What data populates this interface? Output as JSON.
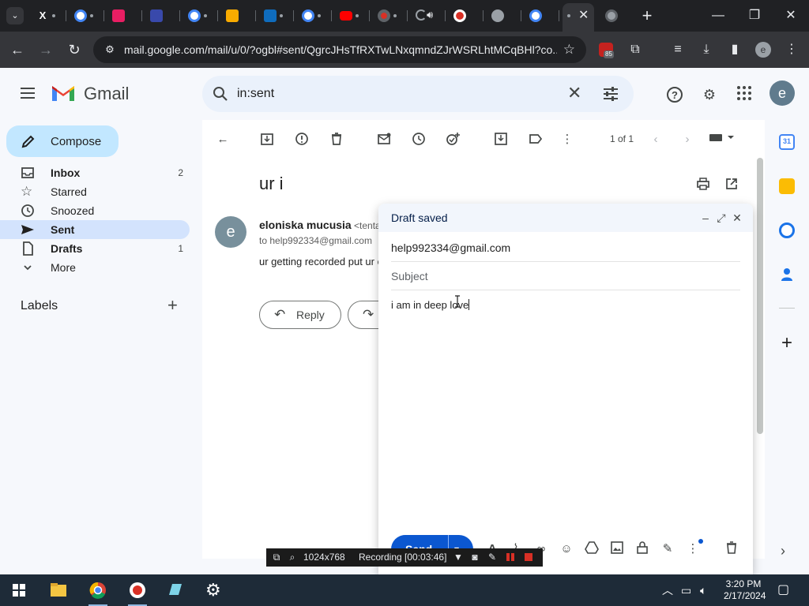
{
  "browser": {
    "tab_search_glyph": "⌄",
    "active_tab_close": "✕",
    "new_tab_glyph": "+",
    "window_controls": {
      "minimize": "—",
      "restore": "❐",
      "close": "✕"
    },
    "url": "mail.google.com/mail/u/0/?ogbl#sent/QgrcJHsTfRXTwLNxqmndZJrWSRLhtMCqBHl?co...",
    "extension_badge": "85",
    "profile_initial": "e",
    "tab_favicon_colors": [
      "#f1f3f4",
      "#4285f4",
      "#e91e63",
      "#3949ab",
      "#4285f4",
      "#f9ab00",
      "#0f6cbd",
      "#4285f4",
      "#ff0000",
      "#d93025",
      "#9aa0a6",
      "#d93025",
      "#9aa0a6",
      "#4285f4",
      "#9aa0a6"
    ]
  },
  "gmail": {
    "wordmark": "Gmail",
    "search_query": "in:sent",
    "clear_glyph": "✕",
    "account_initial": "e",
    "compose_label": "Compose",
    "nav": [
      {
        "label": "Inbox",
        "count": "2",
        "icon": "inbox-icon"
      },
      {
        "label": "Starred",
        "count": "",
        "icon": "star-icon"
      },
      {
        "label": "Snoozed",
        "count": "",
        "icon": "clock-icon"
      },
      {
        "label": "Sent",
        "count": "",
        "icon": "send-icon"
      },
      {
        "label": "Drafts",
        "count": "1",
        "icon": "draft-icon"
      },
      {
        "label": "More",
        "count": "",
        "icon": "chevron-down-icon"
      }
    ],
    "labels_title": "Labels",
    "labels_add": "+",
    "pagination": "1 of 1",
    "message": {
      "subject": "ur i",
      "sender_initial": "e",
      "sender_name": "eloniska mucusia",
      "sender_extra": "<tenta",
      "to_line": "to help992334@gmail.com",
      "snippet": "ur getting recorded put ur c"
    },
    "reply_label": "Reply"
  },
  "draft": {
    "title": "Draft saved",
    "to": "help992334@gmail.com",
    "subject_placeholder": "Subject",
    "body": "i am in deep love",
    "send_label": "Send"
  },
  "recorder": {
    "resolution": "1024x768",
    "status": "Recording [00:03:46]"
  },
  "taskbar": {
    "time": "3:20 PM",
    "date": "2/17/2024"
  },
  "colors": {
    "gmail_bg": "#f6f8fc",
    "compose_bg": "#c2e7ff",
    "active_nav_bg": "#d3e3fd",
    "send_blue": "#0b57d0",
    "chrome_dark": "#202124"
  }
}
